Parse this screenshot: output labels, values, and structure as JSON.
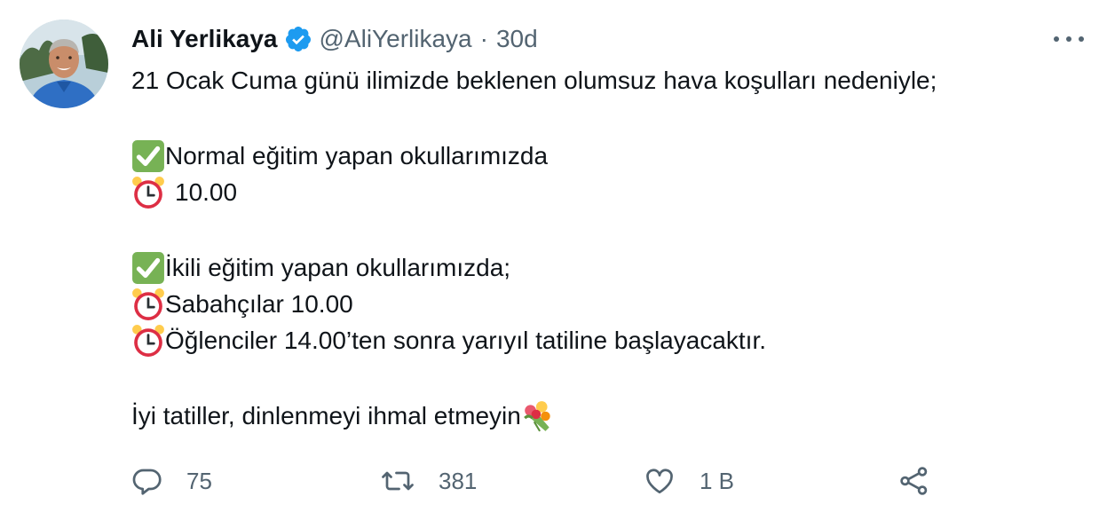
{
  "author": {
    "display_name": "Ali Yerlikaya",
    "handle": "@AliYerlikaya",
    "separator": "·",
    "time": "30d",
    "verified": true,
    "verified_color": "#1d9bf0"
  },
  "tweet": {
    "line1": "21 Ocak Cuma günü ilimizde beklenen olumsuz hava koşulları nedeniyle;",
    "line2": "Normal eğitim yapan okullarımızda",
    "line3": "10.00",
    "line4": "İkili eğitim yapan okullarımızda;",
    "line5": "Sabahçılar 10.00",
    "line6": "Öğlenciler 14.00’ten sonra yarıyıl tatiline başlayacaktır.",
    "line7": "İyi tatiller, dinlenmeyi ihmal etmeyin"
  },
  "actions": {
    "reply_count": "75",
    "retweet_count": "381",
    "like_count": "1 B"
  },
  "icons": {
    "check": "white-heavy-check-mark-emoji",
    "clock": "alarm-clock-emoji",
    "bouquet": "bouquet-emoji",
    "reply": "reply-icon",
    "retweet": "retweet-icon",
    "like": "heart-icon",
    "share": "share-icon",
    "more": "more-icon"
  },
  "colors": {
    "text": "#0f1419",
    "secondary": "#536471",
    "check_green": "#77b255",
    "clock_red": "#dd2e44"
  }
}
